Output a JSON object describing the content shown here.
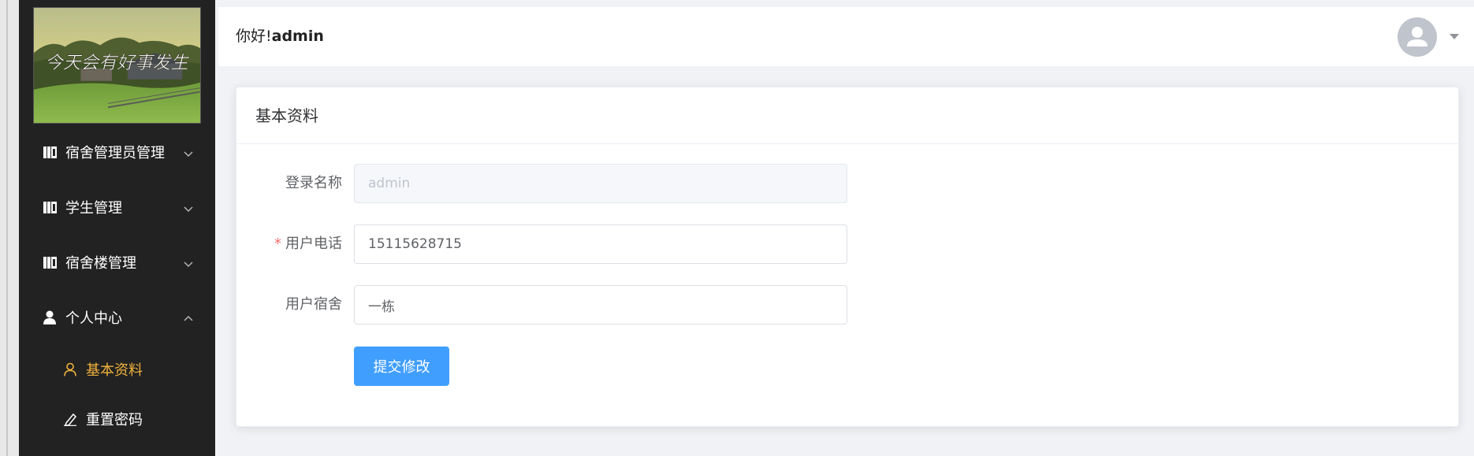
{
  "header": {
    "greeting": "你好!",
    "username": "admin"
  },
  "logo": {
    "text": "今天会有好事发生"
  },
  "sidebar": {
    "items": [
      {
        "label": "宿舍管理员管理",
        "icon": "book-icon",
        "expanded": false
      },
      {
        "label": "学生管理",
        "icon": "book-icon",
        "expanded": false
      },
      {
        "label": "宿舍楼管理",
        "icon": "book-icon",
        "expanded": false
      },
      {
        "label": "个人中心",
        "icon": "user-icon",
        "expanded": true
      }
    ],
    "sub_items": [
      {
        "label": "基本资料",
        "icon": "user-outline-icon",
        "active": true
      },
      {
        "label": "重置密码",
        "icon": "edit-icon",
        "active": false
      }
    ]
  },
  "card": {
    "title": "基本资料"
  },
  "form": {
    "login_name_label": "登录名称",
    "login_name_value": "admin",
    "phone_required_mark": "*",
    "phone_label": "用户电话",
    "phone_value": "15115628715",
    "dorm_label": "用户宿舍",
    "dorm_value": "一栋",
    "submit_label": "提交修改"
  },
  "colors": {
    "sidebar_bg": "#222222",
    "active_menu": "#f0b23c",
    "primary": "#409eff",
    "page_bg": "#f0f2f5"
  }
}
